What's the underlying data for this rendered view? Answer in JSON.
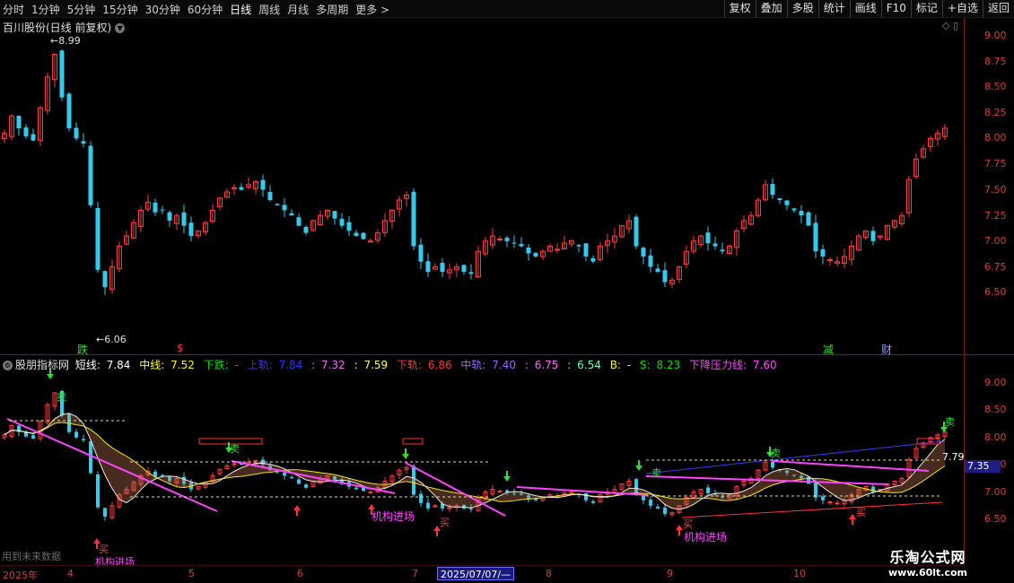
{
  "toolbar": {
    "periods": [
      "分时",
      "1分钟",
      "5分钟",
      "15分钟",
      "30分钟",
      "60分钟",
      "日线",
      "周线",
      "月线",
      "多周期",
      "更多 >"
    ],
    "active_period": "日线",
    "buttons": [
      "复权",
      "叠加",
      "多股",
      "统计",
      "画线",
      "F10",
      "标记",
      "+自选",
      "返回"
    ]
  },
  "main": {
    "title": "百川股份(日线 前复权)",
    "price_axis": [
      "9.00",
      "8.75",
      "8.50",
      "8.25",
      "8.00",
      "7.75",
      "7.50",
      "7.25",
      "7.00",
      "6.75",
      "6.50"
    ],
    "high_label": "8.99",
    "low_label": "6.06",
    "markers": [
      {
        "text": "跌",
        "color": "#33dd33"
      },
      {
        "text": "$",
        "color": "#ee3333"
      },
      {
        "text": "减",
        "color": "#33dd33"
      },
      {
        "text": "财",
        "color": "#8aa0ff"
      }
    ]
  },
  "indicator": {
    "name": "股朋指标网",
    "items": [
      {
        "label": "短线:",
        "value": "7.84",
        "color": "#ffffff"
      },
      {
        "label": "中线:",
        "value": "7.52",
        "color": "#ffff00"
      },
      {
        "label": "下跌:",
        "value": "-",
        "color": "#00dd00"
      },
      {
        "label": "上轨:",
        "value": "7.84",
        "color": "#3333ff"
      },
      {
        "label": ":",
        "value": "7.32",
        "color": "#ff66ff"
      },
      {
        "label": ":",
        "value": "7.59",
        "color": "#ffff66"
      },
      {
        "label": "下轨:",
        "value": "6.86",
        "color": "#ff3333"
      },
      {
        "label": "中轨:",
        "value": "7.40",
        "color": "#9966ff"
      },
      {
        "label": ":",
        "value": "6.75",
        "color": "#ff66ff"
      },
      {
        "label": ":",
        "value": "6.54",
        "color": "#66ffcc"
      },
      {
        "label": "B:",
        "value": "-",
        "color": "#ffff00"
      },
      {
        "label": "S:",
        "value": "8.23",
        "color": "#00dd00"
      },
      {
        "label": "下降压力线:",
        "value": "7.60",
        "color": "#ff44ff"
      }
    ],
    "price_axis": [
      "9.00",
      "8.50",
      "8.00",
      "7.50",
      "7.00",
      "6.50"
    ],
    "current_price": "7.35",
    "right_value": "7.79",
    "labels": {
      "buy": "买",
      "sell": "卖",
      "institution": "机构进场"
    }
  },
  "bottom": {
    "months": [
      "2025年",
      "4",
      "5",
      "6",
      "7",
      "8",
      "9",
      "10"
    ],
    "cursor_date": "2025/07/07/—",
    "future_note": "用到未来数据"
  },
  "watermark": {
    "line1": "乐淘公式网",
    "line2": "www.60lt.com"
  },
  "colors": {
    "up": "#ff3c3c",
    "down": "#33ccee",
    "axis": "#d04040"
  },
  "chart_data": {
    "type": "candlestick",
    "closes": [
      8.05,
      8.22,
      8.1,
      8.02,
      7.98,
      8.3,
      8.6,
      8.82,
      8.4,
      8.1,
      8.0,
      7.95,
      7.35,
      6.72,
      6.55,
      6.75,
      6.95,
      7.05,
      7.18,
      7.3,
      7.38,
      7.28,
      7.3,
      7.2,
      7.25,
      7.15,
      7.05,
      7.1,
      7.18,
      7.3,
      7.42,
      7.48,
      7.52,
      7.5,
      7.55,
      7.58,
      7.5,
      7.4,
      7.35,
      7.3,
      7.25,
      7.15,
      7.08,
      7.2,
      7.25,
      7.3,
      7.22,
      7.15,
      7.1,
      7.05,
      7.02,
      7.0,
      7.08,
      7.2,
      7.3,
      7.4,
      7.45,
      6.95,
      6.8,
      6.7,
      6.75,
      6.7,
      6.72,
      6.75,
      6.7,
      6.68,
      6.9,
      7.0,
      7.05,
      7.02,
      7.0,
      6.98,
      6.95,
      6.88,
      6.85,
      6.9,
      6.95,
      6.92,
      6.98,
      7.0,
      6.95,
      6.85,
      6.8,
      6.95,
      7.0,
      7.05,
      7.15,
      7.2,
      6.95,
      6.85,
      6.75,
      6.7,
      6.6,
      6.62,
      6.75,
      6.9,
      7.0,
      7.05,
      6.98,
      6.95,
      6.9,
      6.95,
      7.1,
      7.2,
      7.25,
      7.4,
      7.55,
      7.45,
      7.4,
      7.35,
      7.3,
      7.25,
      7.15,
      6.9,
      6.85,
      6.82,
      6.8,
      6.85,
      6.95,
      7.05,
      7.1,
      7.0,
      7.05,
      7.15,
      7.2,
      7.25,
      7.6,
      7.8,
      7.9,
      8.0,
      8.05,
      8.1
    ]
  }
}
